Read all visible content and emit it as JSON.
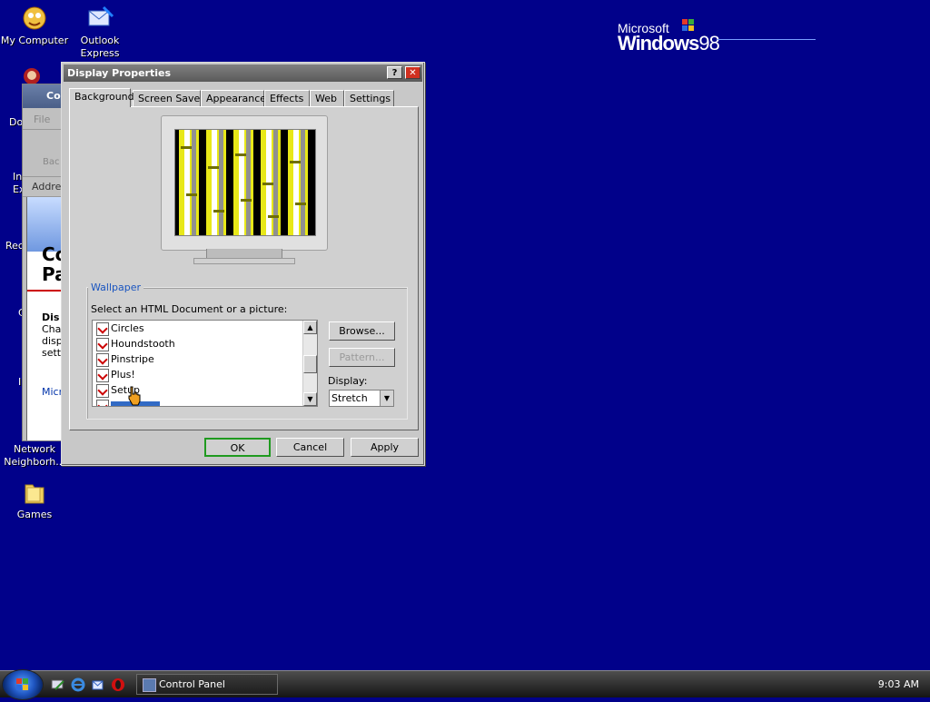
{
  "desktop": {
    "icons": [
      {
        "label_1": "My Computer",
        "label_2": ""
      },
      {
        "label_1": "Outlook",
        "label_2": "Express"
      },
      {
        "label_1": "Network",
        "label_2": "Neighborh..."
      },
      {
        "label_1": "Games",
        "label_2": ""
      }
    ],
    "partial_labels": [
      "Do",
      "In",
      "Ex",
      "Rec",
      "C",
      "I"
    ],
    "logo": {
      "brand": "Microsoft",
      "product": "Windows",
      "version": "98"
    }
  },
  "background_window": {
    "title": "Co",
    "menu": "File",
    "toolbar": "Bac",
    "address": "Addre",
    "content_title_1": "Co",
    "content_title_2": "Pa",
    "desc_1": "Dis",
    "desc_2": "Cha",
    "desc_3": "disp",
    "desc_4": "sett",
    "link": "Micr"
  },
  "dialog": {
    "title": "Display Properties",
    "help_button": "?",
    "close_button": "✕",
    "tabs": [
      "Background",
      "Screen Saver",
      "Appearance",
      "Effects",
      "Web",
      "Settings"
    ],
    "active_tab": "Background",
    "wallpaper_group": "Wallpaper",
    "select_label": "Select an HTML Document or a picture:",
    "list_items": [
      "Circles",
      "Houndstooth",
      "Pinstripe",
      "Plus!",
      "Setup"
    ],
    "browse_button": "Browse...",
    "pattern_button": "Pattern...",
    "display_label": "Display:",
    "display_value": "Stretch",
    "ok_button": "OK",
    "cancel_button": "Cancel",
    "apply_button": "Apply"
  },
  "taskbar": {
    "task_button": "Control Panel",
    "clock": "9:03 AM"
  },
  "colors": {
    "desktop": "#01018a",
    "dialog_face": "#d0d0d0",
    "group_label": "#1a55c0",
    "default_button_border": "#1f9a1f"
  }
}
